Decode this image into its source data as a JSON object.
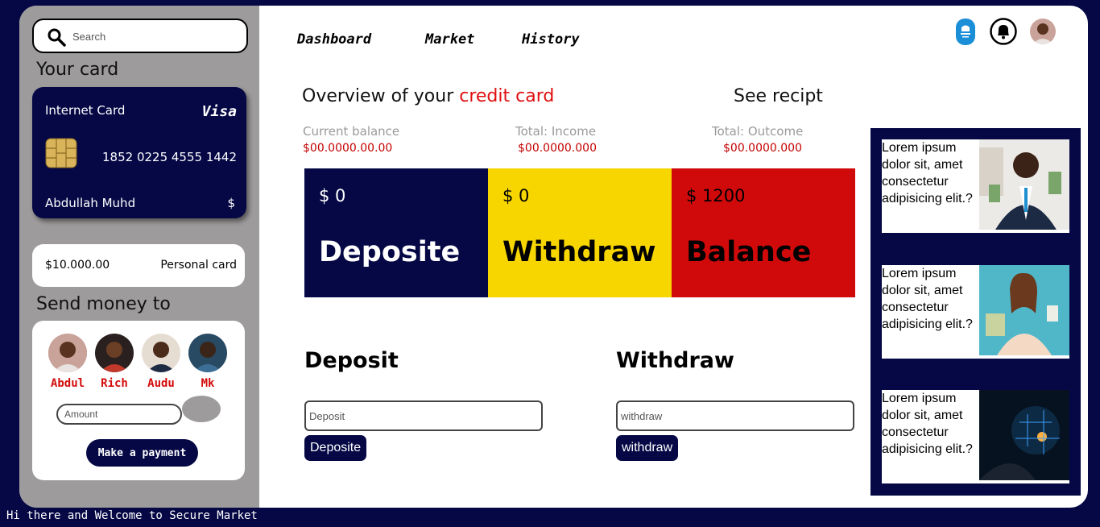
{
  "search": {
    "placeholder": "Search"
  },
  "sidebar": {
    "card_section_title": "Your card",
    "card": {
      "type": "Internet Card",
      "brand": "Visa",
      "number": "1852 0225 4555 1442",
      "holder": "Abdullah Muhd",
      "currency": "$"
    },
    "personal_card": {
      "amount": "$10.000.00",
      "label": "Personal card"
    },
    "send_section_title": "Send money to",
    "contacts": [
      {
        "name": "Abdul"
      },
      {
        "name": "Rich"
      },
      {
        "name": "Audu"
      },
      {
        "name": "Mk"
      }
    ],
    "amount_placeholder": "Amount",
    "pay_button": "Make a payment"
  },
  "nav": {
    "items": [
      "Dashboard",
      "Market",
      "History"
    ]
  },
  "overview": {
    "title_prefix": "Overview of your ",
    "title_accent": "credit card",
    "see_recipt": "See recipt",
    "stats": [
      {
        "label": "Current balance",
        "value": "$00.0000.00.00"
      },
      {
        "label": "Total: Income",
        "value": "$00.0000.000"
      },
      {
        "label": "Total: Outcome",
        "value": "$00.0000.000"
      }
    ]
  },
  "tiles": [
    {
      "amount": "$ 0",
      "label": "Deposite",
      "bg": "#050845",
      "fg": "#ffffff"
    },
    {
      "amount": "$ 0",
      "label": "Withdraw",
      "bg": "#f7d600",
      "fg": "#000000"
    },
    {
      "amount": "$ 1200",
      "label": "Balance",
      "bg": "#d00a0a",
      "fg": "#000000"
    }
  ],
  "deposit": {
    "heading": "Deposit",
    "placeholder": "Deposit",
    "button": "Deposite"
  },
  "withdraw": {
    "heading": "Withdraw",
    "placeholder": "withdraw",
    "button": "withdraw"
  },
  "header_icons": [
    "brand-logo-icon",
    "bell-icon",
    "profile-avatar"
  ],
  "ads": [
    {
      "text": "Lorem ipsum dolor sit, amet consectetur adipisicing elit.?"
    },
    {
      "text": "Lorem ipsum dolor sit, amet consectetur adipisicing elit.?"
    },
    {
      "text": "Lorem ipsum dolor sit, amet consectetur adipisicing elit.?"
    }
  ],
  "status_bar": "Hi there and Welcome to Secure Market",
  "colors": {
    "navy": "#050845",
    "accent_red": "#e01010",
    "yellow": "#f7d600",
    "sidebar_gray": "#9d9b9b"
  }
}
